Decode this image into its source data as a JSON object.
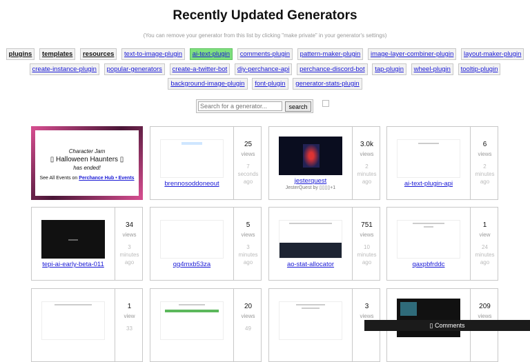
{
  "title": "Recently Updated Generators",
  "subtitle": "(You can remove your generator from this list by clicking \"make private\" in your generator's settings)",
  "tags_row1": [
    "plugins",
    "templates",
    "resources",
    "text-to-image-plugin",
    "ai-text-plugin",
    "comments-plugin",
    "pattern-maker-plugin",
    "image-layer-combiner-plugin",
    "layout-maker-plugin"
  ],
  "tags_row2": [
    "create-instance-plugin",
    "popular-generators",
    "create-a-twitter-bot",
    "diy-perchance-api",
    "perchance-discord-bot",
    "tap-plugin",
    "wheel-plugin",
    "tooltip-plugin"
  ],
  "tags_row3": [
    "background-image-plugin",
    "font-plugin",
    "generator-stats-plugin"
  ],
  "search": {
    "placeholder": "Search for a generator...",
    "button": "search"
  },
  "promo": {
    "line1": "Character Jam",
    "line2": "▯ Halloween Haunters ▯",
    "line3": "has ended!",
    "line4_pre": "See All Events on ",
    "link": "Perchance Hub • Events"
  },
  "cards": [
    {
      "name": "brennosoddoneout",
      "views": "25",
      "unit": "views",
      "time": [
        "7",
        "seconds",
        "ago"
      ],
      "author": "",
      "thumb": "light"
    },
    {
      "name": "jesterquest",
      "views": "3.0k",
      "unit": "views",
      "time": [
        "2",
        "minutes",
        "ago"
      ],
      "author": "JesterQuest by ▯▯▯▯+1",
      "thumb": "night"
    },
    {
      "name": "ai-text-plugin-api",
      "views": "6",
      "unit": "views",
      "time": [
        "2",
        "minutes",
        "ago"
      ],
      "author": "",
      "thumb": "light"
    },
    {
      "name": "tepi-ai-early-beta-011",
      "views": "34",
      "unit": "views",
      "time": [
        "3",
        "minutes",
        "ago"
      ],
      "author": "",
      "thumb": "dark"
    },
    {
      "name": "qq4mxb53za",
      "views": "5",
      "unit": "views",
      "time": [
        "3",
        "minutes",
        "ago"
      ],
      "author": "",
      "thumb": "light"
    },
    {
      "name": "ao-stat-allocator",
      "views": "751",
      "unit": "views",
      "time": [
        "10",
        "minutes",
        "ago"
      ],
      "author": "",
      "thumb": "light"
    },
    {
      "name": "qaxpbfrddc",
      "views": "1",
      "unit": "view",
      "time": [
        "24",
        "minutes",
        "ago"
      ],
      "author": "",
      "thumb": "light"
    },
    {
      "name": "",
      "views": "1",
      "unit": "view",
      "time": [
        "33"
      ],
      "author": "",
      "thumb": "light"
    },
    {
      "name": "",
      "views": "20",
      "unit": "views",
      "time": [
        "49"
      ],
      "author": "",
      "thumb": "light"
    },
    {
      "name": "",
      "views": "3",
      "unit": "views",
      "time": [],
      "author": "",
      "thumb": "light"
    },
    {
      "name": "",
      "views": "209",
      "unit": "views",
      "time": [],
      "author": "",
      "thumb": "dark"
    }
  ],
  "comments_label": "▯ Comments",
  "colors": {
    "link": "#1a1ad6",
    "highlight": "#7ee07e",
    "promo_border": "#b03a78",
    "comments_bar": "#1b1b1b"
  }
}
